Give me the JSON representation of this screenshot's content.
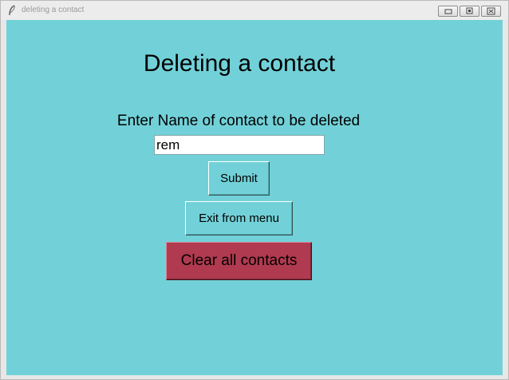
{
  "window": {
    "title": "deleting a contact",
    "icons": {
      "app": "feather-icon",
      "minimize": "minimize-icon",
      "maximize": "maximize-icon",
      "close": "close-icon"
    }
  },
  "form": {
    "heading": "Deleting a contact",
    "prompt_label": "Enter Name of contact to be deleted",
    "name_value": "rem",
    "submit_label": "Submit",
    "exit_label": "Exit from menu",
    "clear_label": "Clear all contacts"
  },
  "colors": {
    "background": "#72d1d8",
    "clear_button": "#b03a50"
  }
}
